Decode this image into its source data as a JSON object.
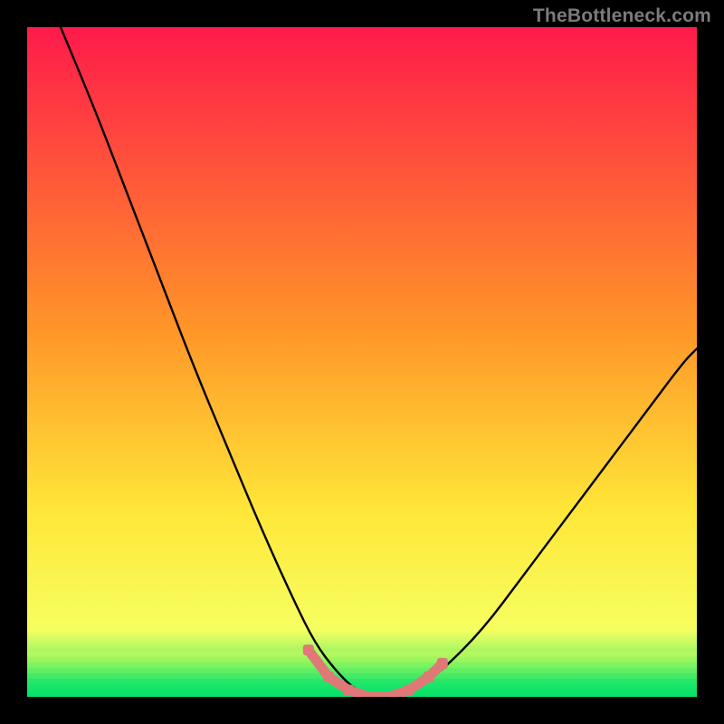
{
  "watermark": "TheBottleneck.com",
  "colors": {
    "frame": "#000000",
    "grad_top": "#ff1a4b",
    "grad_mid1": "#ff9528",
    "grad_mid2": "#ffe638",
    "grad_mid3": "#f6ff60",
    "grad_bottom": "#00e36a",
    "curve": "#000000",
    "marker": "#e07878"
  },
  "chart_data": {
    "type": "line",
    "title": "",
    "xlabel": "",
    "ylabel": "",
    "xlim": [
      0,
      100
    ],
    "ylim": [
      0,
      100
    ],
    "series": [
      {
        "name": "bottleneck-curve",
        "x": [
          5,
          10,
          15,
          20,
          25,
          30,
          35,
          40,
          43,
          46,
          49,
          52,
          55,
          58,
          62,
          68,
          74,
          80,
          86,
          92,
          98,
          100
        ],
        "y": [
          100,
          88,
          75,
          62,
          49,
          37,
          25,
          14,
          8,
          4,
          1,
          0,
          0,
          1,
          4,
          10,
          18,
          26,
          34,
          42,
          50,
          52
        ]
      }
    ],
    "markers": {
      "name": "highlight-band",
      "x": [
        42,
        45,
        48,
        51,
        54,
        57,
        60,
        62
      ],
      "y": [
        7,
        3,
        1,
        0,
        0,
        1,
        3,
        5
      ]
    }
  }
}
